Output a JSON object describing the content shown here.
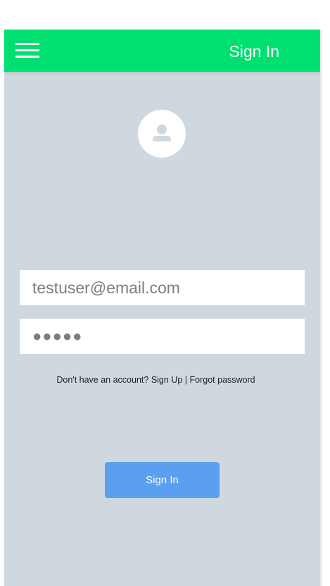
{
  "appbar": {
    "title": "Sign In",
    "background_color": "#00e070",
    "menu_icon": "hamburger-menu-icon"
  },
  "avatar": {
    "icon": "user-avatar-icon"
  },
  "form": {
    "email_value": "testuser@email.com",
    "password_value": "●●●●●"
  },
  "links": {
    "prompt": "Don't have an account?",
    "signup": "Sign Up",
    "separator": "|",
    "forgot": "Forgot password"
  },
  "submit": {
    "label": "Sign In",
    "color": "#5a9ff0"
  },
  "colors": {
    "background": "#cfd8de"
  }
}
